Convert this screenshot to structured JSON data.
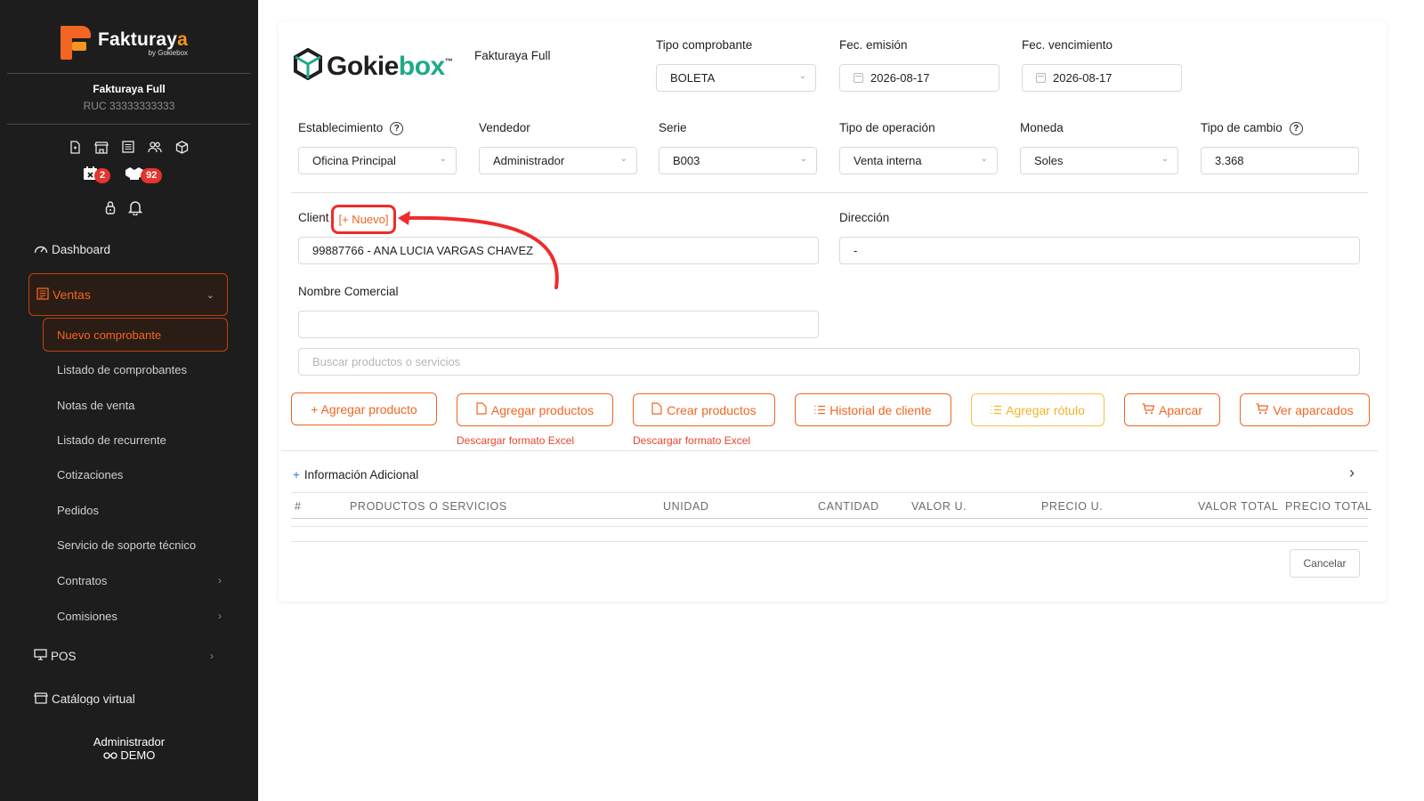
{
  "brand": {
    "name_part1": "Fakturay",
    "name_part2": "a",
    "by": "by Gokiebox"
  },
  "company": {
    "name": "Fakturaya Full",
    "ruc": "RUC 33333333333"
  },
  "badges": {
    "calendar_count": "2",
    "boxes_count": "92"
  },
  "nav": {
    "dashboard": "Dashboard",
    "ventas": "Ventas",
    "ventas_sub": [
      "Nuevo comprobante",
      "Listado de comprobantes",
      "Notas de venta",
      "Listado de recurrente",
      "Cotizaciones",
      "Pedidos",
      "Servicio de soporte técnico",
      "Contratos",
      "Comisiones"
    ],
    "pos": "POS",
    "catalogo": "Catálogo virtual"
  },
  "user": {
    "role": "Administrador",
    "env": "DEMO"
  },
  "header": {
    "logo_part1": "Gokie",
    "logo_part2": "box",
    "logo_tm": "™",
    "company_name": "Fakturaya Full"
  },
  "form": {
    "tipo_comprobante": {
      "label": "Tipo comprobante",
      "value": "BOLETA"
    },
    "fec_emision": {
      "label": "Fec. emisión",
      "value": "2026-08-17"
    },
    "fec_vencimiento": {
      "label": "Fec. vencimiento",
      "value": "2026-08-17"
    },
    "establecimiento": {
      "label": "Establecimiento",
      "value": "Oficina Principal"
    },
    "vendedor": {
      "label": "Vendedor",
      "value": "Administrador"
    },
    "serie": {
      "label": "Serie",
      "value": "B003"
    },
    "tipo_operacion": {
      "label": "Tipo de operación",
      "value": "Venta interna"
    },
    "moneda": {
      "label": "Moneda",
      "value": "Soles"
    },
    "tipo_cambio": {
      "label": "Tipo de cambio",
      "value": "3.368"
    },
    "cliente": {
      "label": "Client",
      "new_link": "[+ Nuevo]",
      "value": "99887766 - ANA LUCIA VARGAS CHAVEZ"
    },
    "direccion": {
      "label": "Dirección",
      "value": "-"
    },
    "nombre_comercial": {
      "label": "Nombre Comercial",
      "value": ""
    },
    "buscar": {
      "placeholder": "Buscar productos o servicios"
    }
  },
  "actions": {
    "agregar_producto": "+ Agregar producto",
    "agregar_productos": "Agregar productos",
    "crear_productos": "Crear productos",
    "historial_cliente": "Historial de cliente",
    "agregar_rotulo": "Agregar rótulo",
    "aparcar": "Aparcar",
    "ver_aparcados": "Ver aparcados",
    "descargar_1": "Descargar formato Excel",
    "descargar_2": "Descargar formato Excel"
  },
  "info_adicional": "Información Adicional",
  "table": {
    "columns": [
      "#",
      "PRODUCTOS O SERVICIOS",
      "UNIDAD",
      "CANTIDAD",
      "VALOR U.",
      "PRECIO U.",
      "VALOR TOTAL",
      "PRECIO TOTAL"
    ]
  },
  "footer": {
    "cancel": "Cancelar"
  },
  "colors": {
    "accent": "#f26522",
    "sidebar_bg": "#1d1d1d",
    "annotation_red": "#ef2b2b",
    "yellow": "#f0b429",
    "brand_green": "#1fa98a"
  }
}
